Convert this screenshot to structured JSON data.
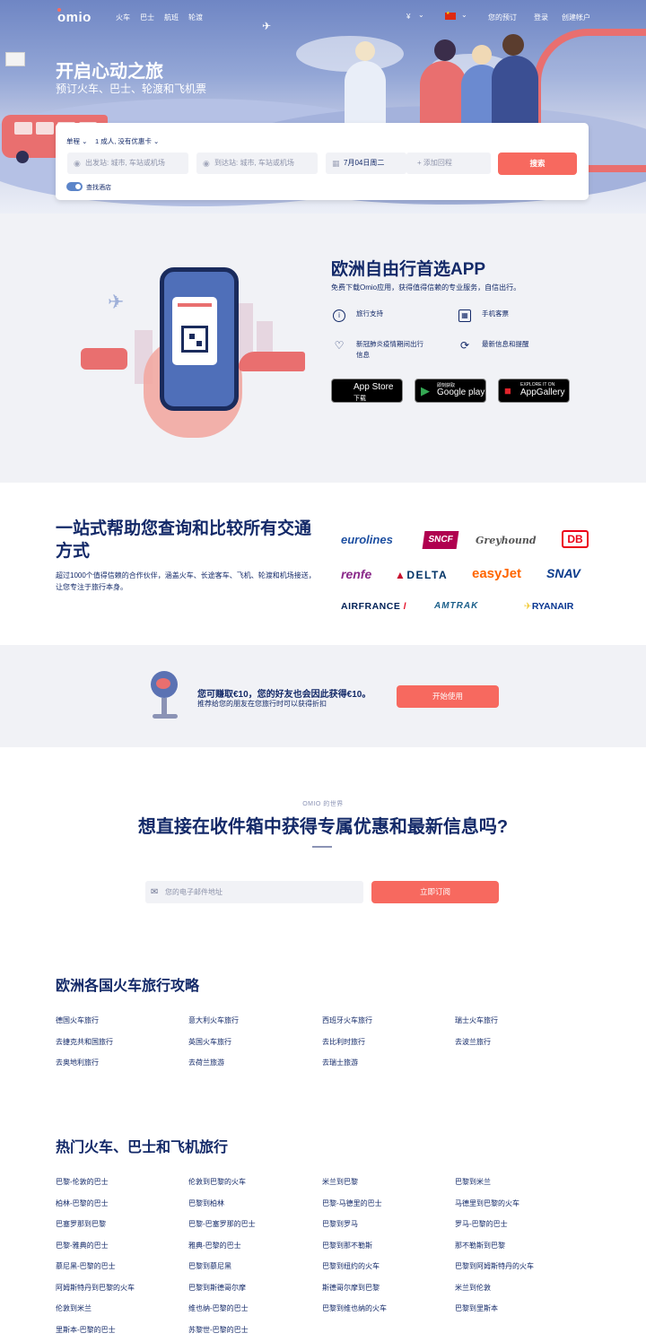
{
  "nav": {
    "logo": "omio",
    "links": [
      "火车",
      "巴士",
      "航班",
      "轮渡"
    ],
    "currency": "¥",
    "my_bookings": "您的预订",
    "login": "登录",
    "signup": "创建帐户"
  },
  "hero": {
    "title": "开启心动之旅",
    "subtitle": "预订火车、巴士、轮渡和飞机票"
  },
  "search": {
    "trip_type": "单程",
    "passengers": "1 成人, 没有优惠卡",
    "from_placeholder": "出发站: 城市, 车站或机场",
    "to_placeholder": "到达站: 城市, 车站或机场",
    "date": "7月04日周二",
    "return": "+ 添加回程",
    "button": "搜索",
    "hotel_toggle": "查找酒店"
  },
  "app": {
    "title": "欧洲自由行首选APP",
    "desc": "免费下载Omio应用，获得值得信赖的专业服务，自信出行。",
    "features": [
      {
        "icon": "info-icon",
        "label": "旅行支持"
      },
      {
        "icon": "qr-icon",
        "label": "手机客票"
      },
      {
        "icon": "heart-icon",
        "label": "新冠肺炎疫情期间出行"
      },
      {
        "icon": "refresh-icon",
        "label": "最新信息和提醒"
      }
    ],
    "feature3_line2": "信息",
    "stores": [
      {
        "small": "",
        "big": "App Store",
        "sub": "下载"
      },
      {
        "small": "即刻获取",
        "big": "Google play",
        "sub": ""
      },
      {
        "small": "EXPLORE IT ON",
        "big": "AppGallery",
        "sub": ""
      }
    ]
  },
  "partners": {
    "title": "一站式帮助您查询和比较所有交通方式",
    "desc": "超过1000个值得信赖的合作伙伴，涵盖火车、长途客车、飞机、轮渡和机场接送，让您专注于旅行本身。",
    "brands": [
      "eurolines",
      "SNCF",
      "Greyhound",
      "DB",
      "renfe",
      "DELTA",
      "easyJet",
      "SNAV",
      "AIRFRANCE",
      "AMTRAK",
      "RYANAIR"
    ]
  },
  "referral": {
    "title": "您可赚取€10，您的好友也会因此获得€10。",
    "sub": "推荐给您的朋友在您旅行时可以获得折扣",
    "button": "开始使用"
  },
  "newsletter": {
    "kicker": "OMIO 的世界",
    "title": "想直接在收件箱中获得专属优惠和最新信息吗?",
    "placeholder": "您的电子邮件地址",
    "button": "立即订阅"
  },
  "guides": {
    "title": "欧洲各国火车旅行攻略",
    "links": [
      "德国火车旅行",
      "意大利火车旅行",
      "西班牙火车旅行",
      "瑞士火车旅行",
      "去捷克共和国旅行",
      "英国火车旅行",
      "去比利时旅行",
      "去波兰旅行",
      "去奥地利旅行",
      "去荷兰旅游",
      "去瑞士旅游"
    ]
  },
  "popular": {
    "title": "热门火车、巴士和飞机旅行",
    "links": [
      "巴黎-伦敦的巴士",
      "伦敦到巴黎的火车",
      "米兰到巴黎",
      "巴黎到米兰",
      "柏林-巴黎的巴士",
      "巴黎到柏林",
      "巴黎-马德里的巴士",
      "马德里到巴黎的火车",
      "巴塞罗那到巴黎",
      "巴黎-巴塞罗那的巴士",
      "巴黎到罗马",
      "罗马-巴黎的巴士",
      "巴黎-雅典的巴士",
      "雅典-巴黎的巴士",
      "巴黎到那不勒斯",
      "那不勒斯到巴黎",
      "慕尼黑-巴黎的巴士",
      "巴黎到慕尼黑",
      "巴黎到纽约的火车",
      "巴黎到阿姆斯特丹的火车",
      "阿姆斯特丹到巴黎的火车",
      "巴黎到斯德哥尔摩",
      "斯德哥尔摩到巴黎",
      "米兰到伦敦",
      "伦敦到米兰",
      "维也纳-巴黎的巴士",
      "巴黎到维也纳的火车",
      "巴黎到里斯本",
      "里斯本-巴黎的巴士",
      "苏黎世-巴黎的巴士"
    ]
  }
}
